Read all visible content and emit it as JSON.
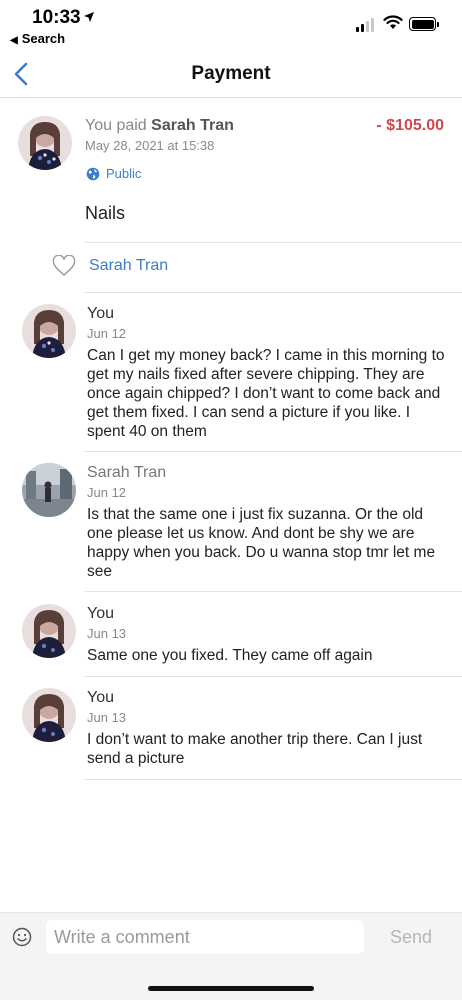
{
  "status_bar": {
    "time": "10:33",
    "back_label": "Search"
  },
  "nav": {
    "title": "Payment"
  },
  "payment": {
    "prefix": "You paid",
    "recipient": "Sarah Tran",
    "amount": "- $105.00",
    "date": "May 28, 2021 at 15:38",
    "privacy": "Public",
    "note": "Nails"
  },
  "likes": {
    "names": "Sarah Tran"
  },
  "comments": [
    {
      "author": "You",
      "date": "Jun 12",
      "text": "Can I get my money back? I came in this morning to get my nails fixed after severe chipping.  They are once again chipped? I don’t want to come back and get them fixed. I can send a picture if you like.  I spent 40 on them"
    },
    {
      "author": "Sarah Tran",
      "date": "Jun 12",
      "text": "Is that the same one i just fix suzanna. Or the old one please let us know. And dont be shy we are happy when you back. Do u wanna stop tmr let me see"
    },
    {
      "author": "You",
      "date": "Jun 13",
      "text": "Same one you fixed. They came off again"
    },
    {
      "author": "You",
      "date": "Jun 13",
      "text": "I don’t want to make another trip there.  Can I just send a picture"
    }
  ],
  "composer": {
    "placeholder": "Write a comment",
    "send_label": "Send"
  },
  "colors": {
    "accent": "#3d7cc9",
    "amount": "#d0484f"
  },
  "icons": [
    "location-arrow-icon",
    "signal-icon",
    "wifi-icon",
    "battery-icon",
    "chevron-left-icon",
    "globe-icon",
    "heart-outline-icon",
    "emoji-icon"
  ]
}
